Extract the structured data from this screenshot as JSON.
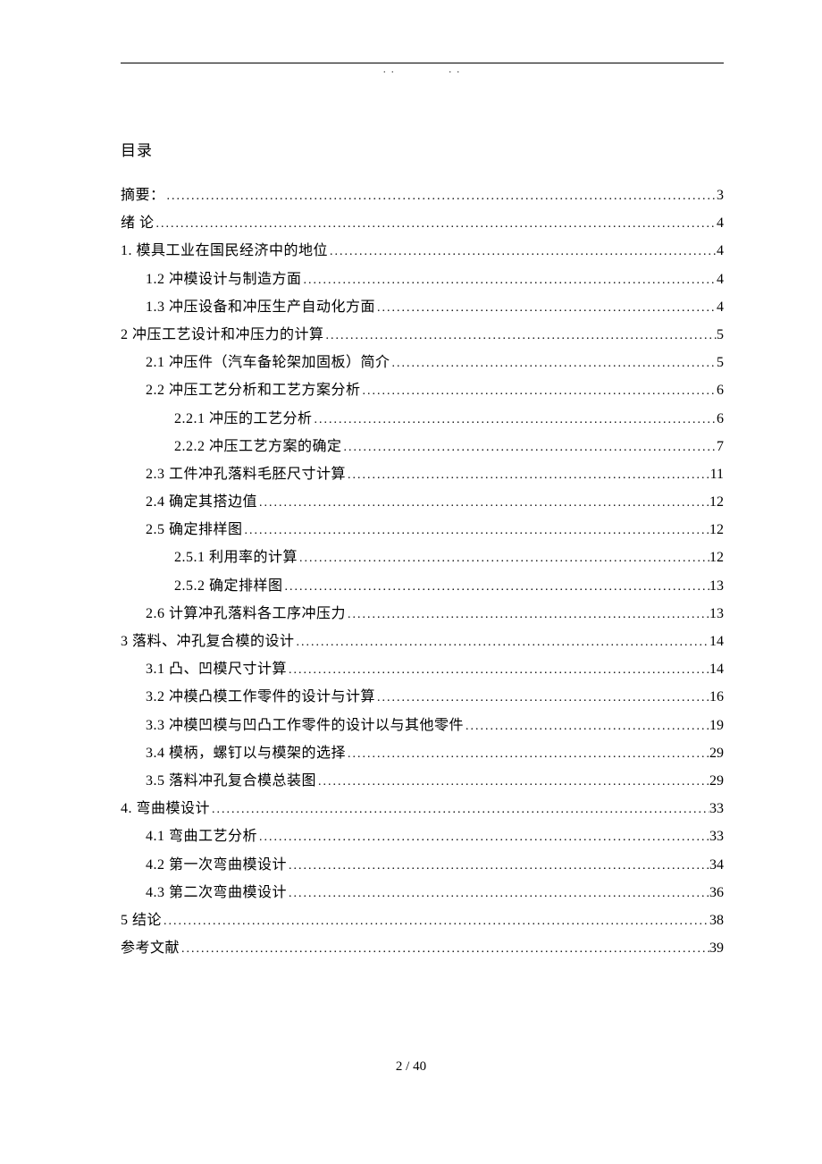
{
  "title": "目录",
  "header_marks": [
    ". .",
    ". ."
  ],
  "toc": [
    {
      "label": "摘要：",
      "page": "3",
      "level": 0
    },
    {
      "label": "绪 论",
      "page": "4",
      "level": 0
    },
    {
      "label": "1. 模具工业在国民经济中的地位",
      "page": "4",
      "level": 0
    },
    {
      "label": "1.2 冲模设计与制造方面",
      "page": "4",
      "level": 1
    },
    {
      "label": "1.3 冲压设备和冲压生产自动化方面",
      "page": "4",
      "level": 1
    },
    {
      "label": "2  冲压工艺设计和冲压力的计算",
      "page": "5",
      "level": 0
    },
    {
      "label": "2.1 冲压件（汽车备轮架加固板）简介",
      "page": "5",
      "level": 1
    },
    {
      "label": "2.2 冲压工艺分析和工艺方案分析",
      "page": "6",
      "level": 1
    },
    {
      "label": "2.2.1 冲压的工艺分析",
      "page": "6",
      "level": 2
    },
    {
      "label": "2.2.2 冲压工艺方案的确定",
      "page": "7",
      "level": 2
    },
    {
      "label": "2.3 工件冲孔落料毛胚尺寸计算",
      "page": "11",
      "level": 1
    },
    {
      "label": "2.4 确定其搭边值",
      "page": "12",
      "level": 1
    },
    {
      "label": "2.5 确定排样图",
      "page": "12",
      "level": 1
    },
    {
      "label": "2.5.1 利用率的计算",
      "page": "12",
      "level": 2
    },
    {
      "label": "2.5.2 确定排样图",
      "page": "13",
      "level": 2
    },
    {
      "label": "2.6 计算冲孔落料各工序冲压力",
      "page": "13",
      "level": 1
    },
    {
      "label": "3 落料、冲孔复合模的设计",
      "page": "14",
      "level": 0
    },
    {
      "label": "3.1 凸、凹模尺寸计算",
      "page": "14",
      "level": 1
    },
    {
      "label": "3.2 冲模凸模工作零件的设计与计算",
      "page": "16",
      "level": 1
    },
    {
      "label": "3.3 冲模凹模与凹凸工作零件的设计以与其他零件",
      "page": "19",
      "level": 1
    },
    {
      "label": "3.4 模柄，螺钉以与模架的选择",
      "page": "29",
      "level": 1
    },
    {
      "label": "3.5 落料冲孔复合模总装图",
      "page": "29",
      "level": 1
    },
    {
      "label": "4. 弯曲模设计",
      "page": "33",
      "level": 0
    },
    {
      "label": "4.1 弯曲工艺分析",
      "page": "33",
      "level": 1
    },
    {
      "label": "4.2 第一次弯曲模设计",
      "page": "34",
      "level": 1
    },
    {
      "label": "4.3 第二次弯曲模设计",
      "page": "36",
      "level": 1
    },
    {
      "label": "5 结论",
      "page": "38",
      "level": 0
    },
    {
      "label": "参考文献",
      "page": "39",
      "level": 0
    }
  ],
  "page_number": "2 / 40"
}
